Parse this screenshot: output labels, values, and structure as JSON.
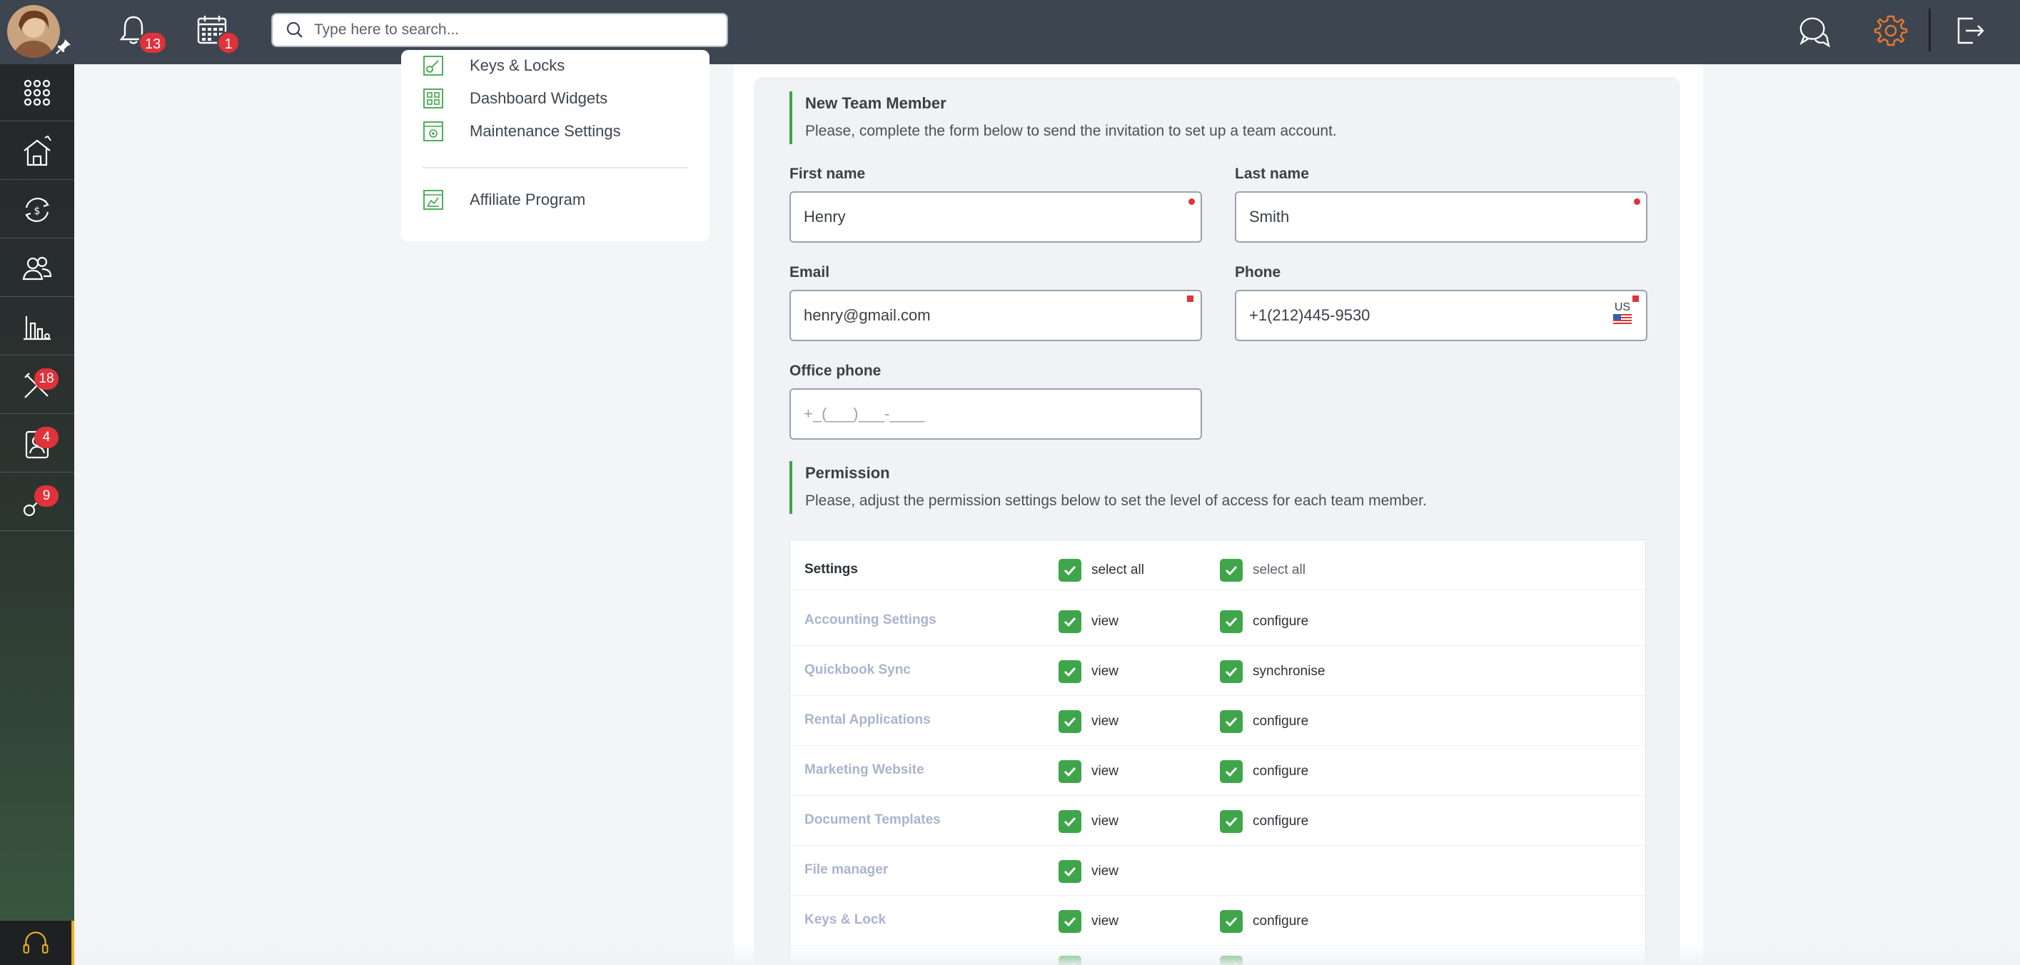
{
  "topbar": {
    "notifications_count": "13",
    "calendar_count": "1",
    "search_placeholder": "Type here to search..."
  },
  "sidebar": {
    "items": [
      {
        "icon": "apps-grid-icon",
        "badge": ""
      },
      {
        "icon": "property-icon",
        "badge": ""
      },
      {
        "icon": "accounting-icon",
        "badge": ""
      },
      {
        "icon": "people-icon",
        "badge": ""
      },
      {
        "icon": "reports-icon",
        "badge": ""
      },
      {
        "icon": "maintenance-tools-icon",
        "badge": "18"
      },
      {
        "icon": "tenant-contact-icon",
        "badge": "4"
      },
      {
        "icon": "keys-icon",
        "badge": "9"
      }
    ]
  },
  "settings_menu": {
    "items": [
      {
        "label": "Keys & Locks",
        "icon": "key-icon"
      },
      {
        "label": "Dashboard Widgets",
        "icon": "widgets-icon"
      },
      {
        "label": "Maintenance Settings",
        "icon": "maintenance-settings-icon"
      },
      {
        "label": "Affiliate Program",
        "icon": "affiliate-icon"
      }
    ]
  },
  "new_member": {
    "title": "New Team Member",
    "description": "Please, complete the form below to send the invitation to set up a team account.",
    "first_name_label": "First name",
    "first_name_value": "Henry",
    "last_name_label": "Last name",
    "last_name_value": "Smith",
    "email_label": "Email",
    "email_value": "henry@gmail.com",
    "phone_label": "Phone",
    "phone_value": "+1(212)445-9530",
    "phone_country": "US",
    "office_phone_label": "Office phone",
    "office_phone_placeholder": "+_(___)___-____"
  },
  "permission": {
    "title": "Permission",
    "description": "Please, adjust the permission settings below to set the level of access for each team member.",
    "header": {
      "name": "Settings",
      "col1": "select all",
      "col2": "select all"
    },
    "rows": [
      {
        "name": "Accounting Settings",
        "col1": "view",
        "col2": "configure"
      },
      {
        "name": "Quickbook Sync",
        "col1": "view",
        "col2": "synchronise"
      },
      {
        "name": "Rental Applications",
        "col1": "view",
        "col2": "configure"
      },
      {
        "name": "Marketing Website",
        "col1": "view",
        "col2": "configure"
      },
      {
        "name": "Document Templates",
        "col1": "view",
        "col2": "configure"
      },
      {
        "name": "File manager",
        "col1": "view",
        "col2": ""
      },
      {
        "name": "Keys & Lock",
        "col1": "view",
        "col2": "configure"
      }
    ]
  },
  "colors": {
    "topbar": "#3d4650",
    "accent_green": "#3fa54a",
    "badge_red": "#e0323b",
    "gear_orange": "#e8782e"
  }
}
